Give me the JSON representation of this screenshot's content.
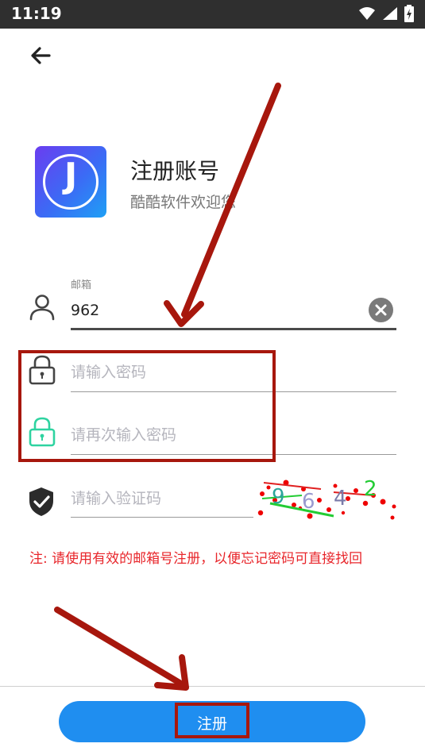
{
  "status_bar": {
    "time": "11:19",
    "icons": [
      "wifi-icon",
      "signal-icon",
      "battery-charging-icon"
    ]
  },
  "header": {
    "back_icon": "arrow-left-icon",
    "logo_letter": "J",
    "title": "注册账号",
    "subtitle": "酷酷软件欢迎您"
  },
  "form": {
    "email": {
      "label": "邮箱",
      "value": "962",
      "icon": "user-icon"
    },
    "password": {
      "placeholder": "请输入密码",
      "icon": "lock-icon"
    },
    "confirm_password": {
      "placeholder": "请再次输入密码",
      "icon": "lock-icon",
      "icon_color": "#2ed3a0"
    },
    "captcha": {
      "placeholder": "请输入验证码",
      "icon": "shield-check-icon",
      "code": [
        "9",
        "6",
        "4",
        "2"
      ]
    },
    "note": "注: 请使用有效的邮箱号注册，以便忘记密码可直接找回"
  },
  "footer": {
    "register_label": "注册"
  },
  "colors": {
    "primary": "#1f8ef0",
    "note_red": "#e8262b",
    "annotation_red": "#a7170d"
  }
}
